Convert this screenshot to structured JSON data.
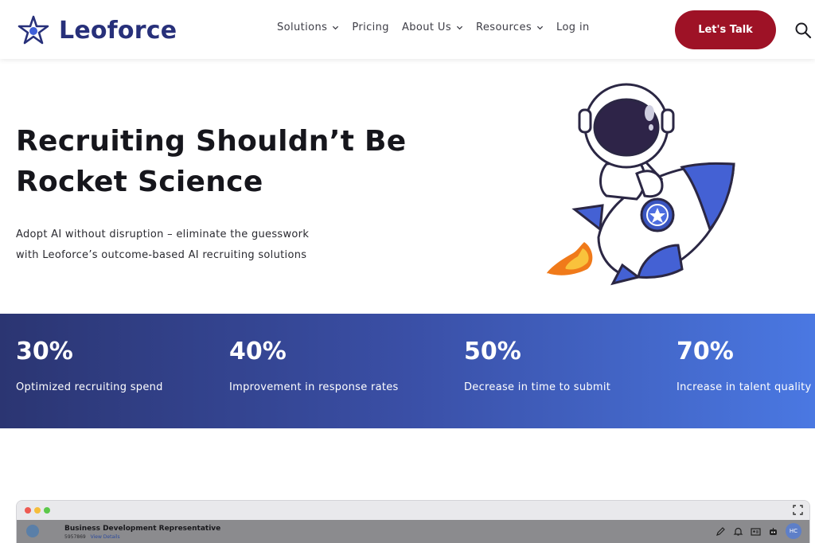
{
  "brand": {
    "name": "Leoforce",
    "color": "#27307a"
  },
  "nav": {
    "items": [
      {
        "label": "Solutions",
        "has_dropdown": true
      },
      {
        "label": "Pricing",
        "has_dropdown": false
      },
      {
        "label": "About Us",
        "has_dropdown": true
      },
      {
        "label": "Resources",
        "has_dropdown": true
      },
      {
        "label": "Log in",
        "has_dropdown": false
      }
    ],
    "cta_label": "Let's Talk",
    "cta_color": "#9e1226",
    "search_icon": "search-icon"
  },
  "hero": {
    "title_line1": "Recruiting Shouldn’t Be",
    "title_line2": "Rocket Science",
    "subtitle_line1": "Adopt AI without disruption – eliminate the guesswork",
    "subtitle_line2": "with Leoforce’s outcome-based AI recruiting solutions",
    "illustration": "astronaut-riding-rocket"
  },
  "stats": [
    {
      "value": "30%",
      "label": "Optimized recruiting spend"
    },
    {
      "value": "40%",
      "label": "Improvement in response rates"
    },
    {
      "value": "50%",
      "label": "Decrease in time to submit"
    },
    {
      "value": "70%",
      "label": "Increase in talent quality"
    }
  ],
  "preview": {
    "job_title": "Business Development Representative",
    "job_id": "5957869",
    "link_text": "View Details",
    "avatar_initials": "HC",
    "window_dots": [
      "#ee5a52",
      "#f5bd3b",
      "#5cc84a"
    ]
  }
}
